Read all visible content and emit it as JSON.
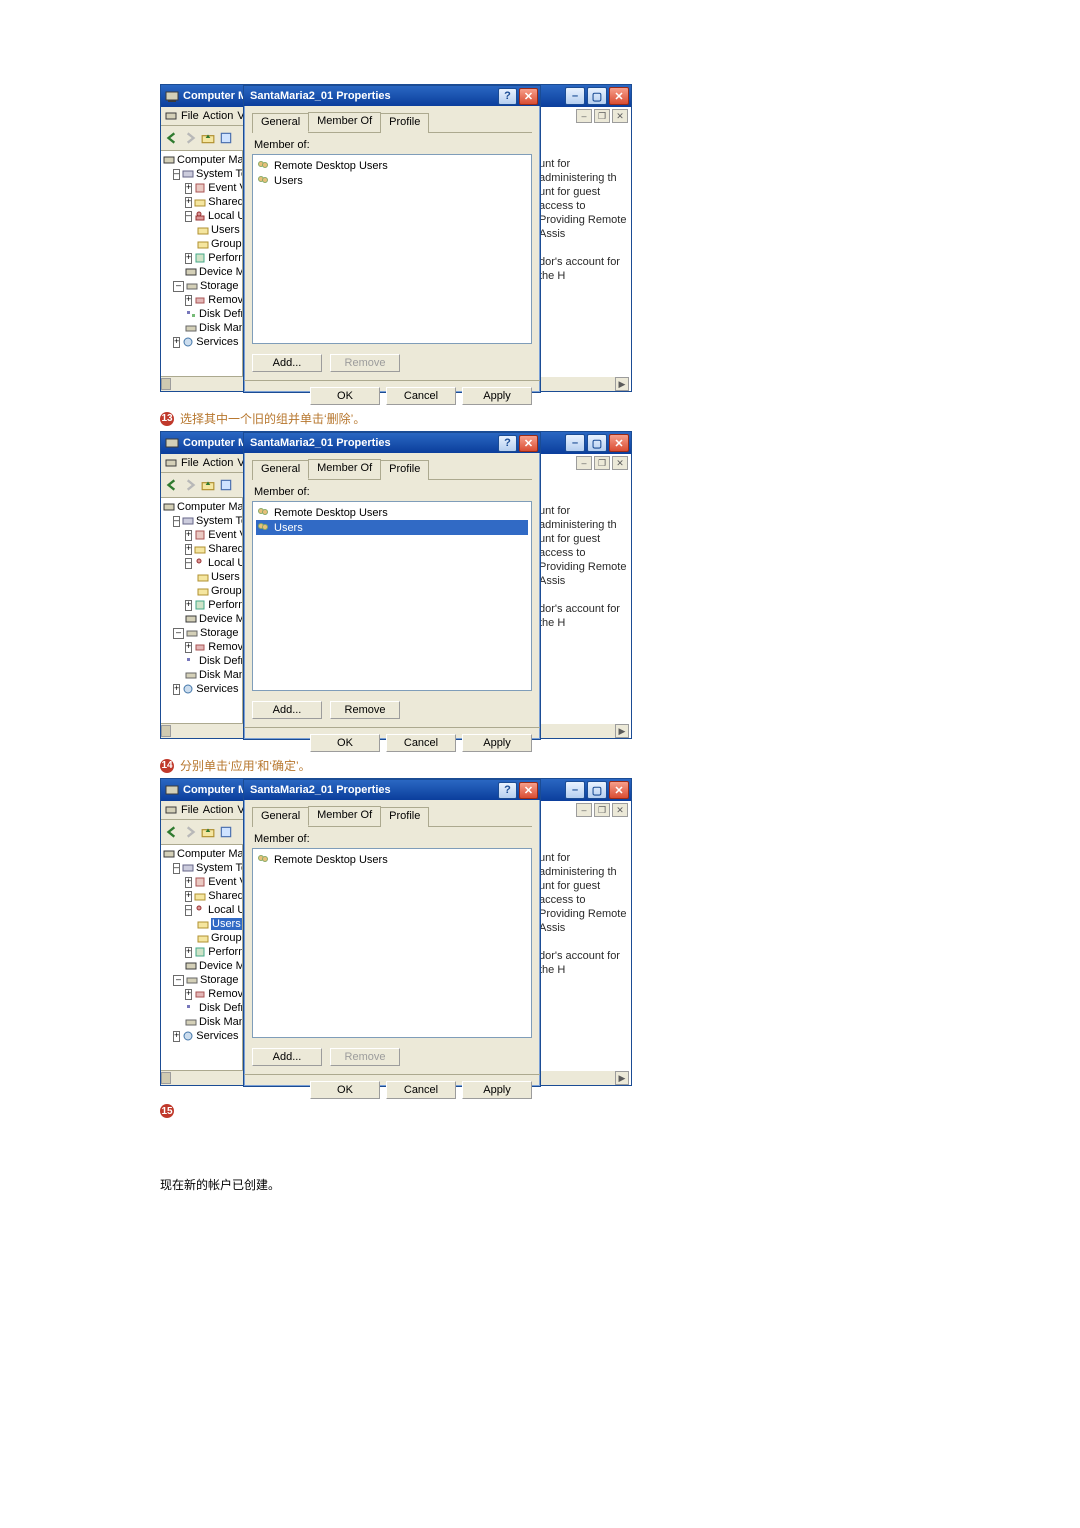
{
  "steps": {
    "s13": {
      "num": "13",
      "caption": "选择其中一个旧的组并单击‘删除’。"
    },
    "s14": {
      "num": "14",
      "caption": "分别单击‘应用’和‘确定’。"
    },
    "s15": {
      "num": "15"
    },
    "final_line": "现在新的帐户已创建。"
  },
  "mmc": {
    "title": "Computer Man",
    "menu_file": "File",
    "menu_action": "Action",
    "menu_view": "Vi",
    "tree": {
      "root": "Computer Manager",
      "system_tools": "System Tools",
      "event_view": "Event View",
      "shared_fol": "Shared Fol",
      "local_users": "Local Users",
      "users": "Users",
      "groups": "Groups",
      "performance": "Performanc",
      "device_man": "Device Man",
      "storage": "Storage",
      "removable": "Removable",
      "disk_defrag": "Disk Defrag",
      "disk_manag": "Disk Manag",
      "services": "Services and A"
    },
    "right_fragments": {
      "f1": "unt for administering th",
      "f2": "unt for guest access to",
      "f3": "Providing Remote Assis",
      "f4": "dor's account for the H"
    }
  },
  "props": {
    "title": "SantaMaria2_01 Properties",
    "tab_general": "General",
    "tab_member": "Member Of",
    "tab_profile": "Profile",
    "member_of_label": "Member of:",
    "item_rdu": "Remote Desktop Users",
    "item_users": "Users",
    "btn_add": "Add...",
    "btn_remove": "Remove",
    "btn_ok": "OK",
    "btn_cancel": "Cancel",
    "btn_apply": "Apply"
  }
}
